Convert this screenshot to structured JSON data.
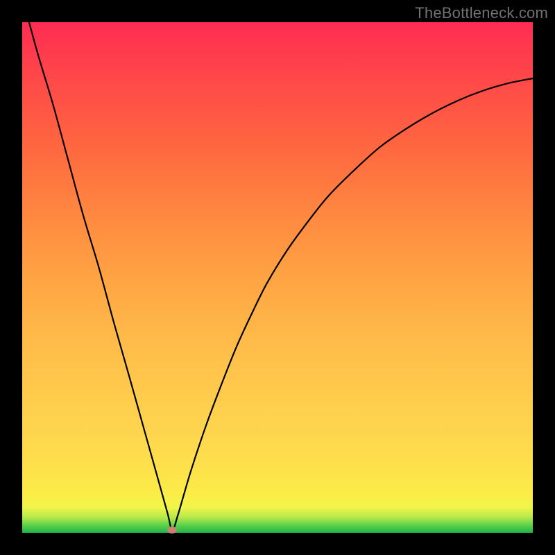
{
  "watermark": "TheBottleneck.com",
  "colors": {
    "curve": "#000000",
    "marker": "#cb8171",
    "frame": "#000000"
  },
  "chart_data": {
    "type": "line",
    "title": "",
    "xlabel": "",
    "ylabel": "",
    "xlim": [
      0,
      100
    ],
    "ylim": [
      0,
      100
    ],
    "grid": false,
    "legend": false,
    "series": [
      {
        "name": "bottleneck-curve",
        "x": [
          0,
          3,
          6,
          9,
          12,
          15,
          18,
          21,
          24,
          27,
          28.5,
          29.4,
          30.5,
          33,
          36,
          39,
          42,
          45,
          48,
          52,
          56,
          60,
          65,
          70,
          75,
          80,
          85,
          90,
          95,
          100
        ],
        "y": [
          105,
          94,
          84,
          73,
          62,
          52,
          41,
          30.5,
          19.8,
          9.1,
          3.7,
          0.5,
          3.5,
          12,
          21,
          29,
          36.5,
          43,
          49,
          55.5,
          61,
          66,
          71,
          75.5,
          79,
          82,
          84.5,
          86.5,
          88,
          89
        ]
      }
    ],
    "marker": {
      "x": 29.4,
      "y": 0.5
    },
    "annotations": []
  }
}
